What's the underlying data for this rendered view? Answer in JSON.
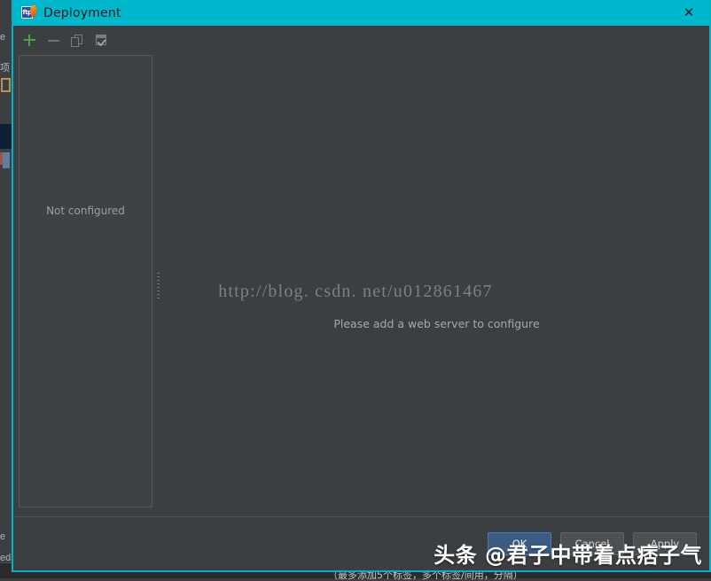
{
  "window": {
    "title": "Deployment",
    "icon": "ftp-deployment-icon",
    "icon_text": "ftp",
    "close_label": "✕",
    "accent_color": "#00b8ce",
    "background_color": "#3c3f41"
  },
  "toolbar": {
    "buttons": [
      {
        "name": "add-server-button",
        "icon": "plus-icon",
        "label": "+",
        "enabled": true
      },
      {
        "name": "remove-server-button",
        "icon": "minus-icon",
        "label": "−",
        "enabled": false
      },
      {
        "name": "copy-server-button",
        "icon": "copy-icon",
        "label": "Copy",
        "enabled": false
      },
      {
        "name": "use-as-default-button",
        "icon": "set-default-icon",
        "label": "Use as Default",
        "enabled": false
      }
    ]
  },
  "server_list": {
    "empty_text": "Not configured",
    "items": []
  },
  "splitter": {
    "name": "pane-splitter",
    "grip": "drag-dots"
  },
  "detail_pane": {
    "hint": "Please add a web server to configure"
  },
  "watermarks": {
    "url": "http://blog. csdn. net/u012861467",
    "toutiao": "头条 @君子中带着点痞子气"
  },
  "footer": {
    "buttons": [
      {
        "name": "ok-button",
        "label": "OK",
        "primary": true
      },
      {
        "name": "cancel-button",
        "label": "Cancel",
        "primary": false
      },
      {
        "name": "apply-button",
        "label": "Apply",
        "primary": false
      }
    ]
  },
  "background_ide": {
    "fragments": [
      {
        "name": "ide-text-fragment-e",
        "text": "e"
      },
      {
        "name": "ide-text-fragment-xiang",
        "text": "项"
      }
    ],
    "bottom_fragments": [
      {
        "name": "ide-text-fragment-e2",
        "text": "e"
      },
      {
        "name": "ide-text-fragment-ed",
        "text": "ed"
      }
    ],
    "bottom_tip": "（最多添加5个标签，多个标签/间用，分隔）"
  }
}
